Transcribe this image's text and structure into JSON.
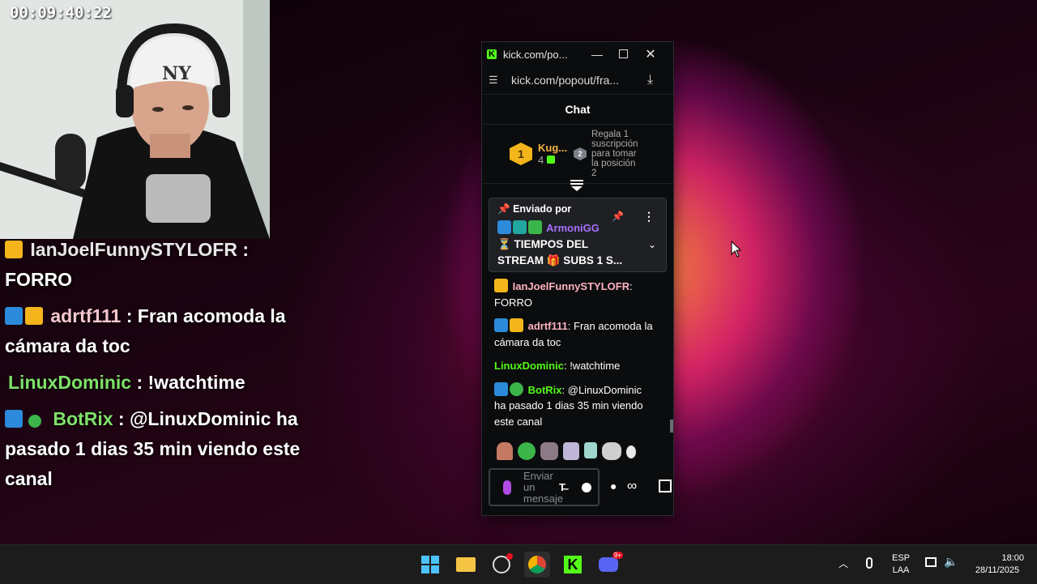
{
  "stream": {
    "timer": "00:09:40:22"
  },
  "overlay": {
    "messages": [
      {
        "user": "IanJoelFunnySTYLOFR",
        "text": "FORRO",
        "user_color": "#ffffff"
      },
      {
        "user": "adrtf111",
        "text": "Fran acomoda la cámara da toc",
        "user_color": "#ffb3c0"
      },
      {
        "user": "LinuxDominic",
        "text": "!watchtime",
        "user_color": "#7ee16a"
      },
      {
        "user": "BotRix",
        "text": "@LinuxDominic ha pasado 1 dias 35 min viendo este canal",
        "user_color": "#7ee16a"
      }
    ]
  },
  "window": {
    "title": "kick.com/po...",
    "url": "kick.com/popout/fra...",
    "chat_title": "Chat"
  },
  "leaderboard": {
    "rank1_name": "Kug...",
    "rank1_count": "4",
    "rank2_number": "2",
    "rank2_text": "Regala 1 suscripción para tomar la posición 2"
  },
  "pinned": {
    "label": "Enviado por",
    "user": "ArmoniGG",
    "text_line1": "⏳ TIEMPOS DEL",
    "text_line2": "STREAM 🎁 SUBS 1 S..."
  },
  "chat": {
    "messages": [
      {
        "user": "IanJoelFunnySTYLOFR",
        "text": "FORRO",
        "color": "#ffb3c0"
      },
      {
        "user": "adrtf111",
        "text": "Fran acomoda la cámara da toc",
        "color": "#ffb3c0"
      },
      {
        "user": "LinuxDominic",
        "text": "!watchtime",
        "color": "#53fc18"
      },
      {
        "user": "BotRix",
        "text": "@LinuxDominic ha pasado 1 dias 35 min viendo este canal",
        "color": "#53fc18"
      }
    ],
    "input_placeholder": "Enviar un mensaje"
  },
  "tray": {
    "lang_top": "ESP",
    "lang_bottom": "LAA",
    "time": "18:00",
    "date": "28/11/2025",
    "discord_badge": "9+"
  },
  "colors": {
    "kick_green": "#53fc18",
    "accent_purple": "#a970ff"
  }
}
